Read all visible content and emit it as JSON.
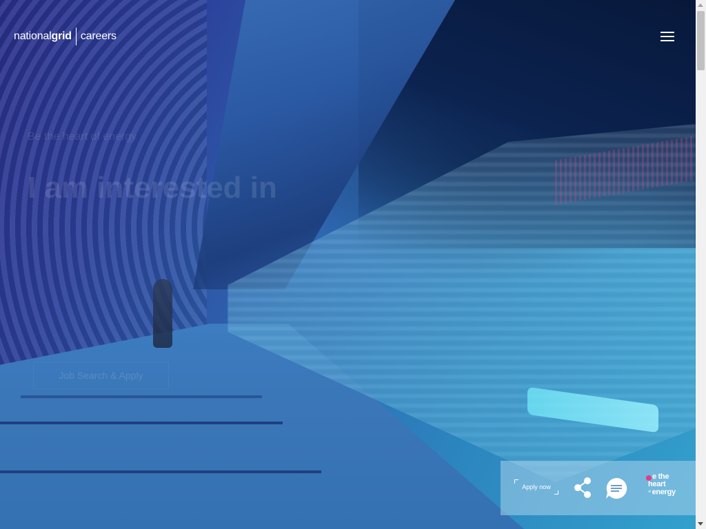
{
  "header": {
    "logo_national": "national",
    "logo_grid": "grid",
    "logo_careers": "careers",
    "menu_icon": "hamburger-menu-icon"
  },
  "hero": {
    "eyebrow": "Be the heart of energy",
    "headline": "I am interested in",
    "cta_label": "Job Search & Apply"
  },
  "action_bar": {
    "apply_label": "Apply now",
    "share_icon": "share-icon",
    "chat_icon": "chat-bubble-icon",
    "badge_line1": "e the",
    "badge_line2": "heart",
    "badge_tiny": "of",
    "badge_line3": "energy"
  },
  "colors": {
    "brand_pink": "#e6388c",
    "overlay_blue": "#2c84be",
    "text_white": "#ffffff"
  }
}
